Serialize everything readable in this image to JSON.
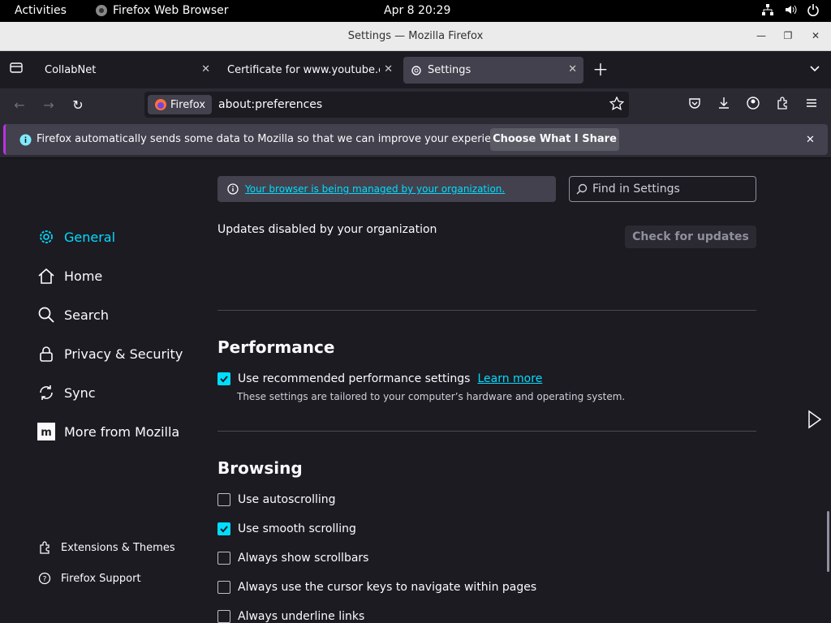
{
  "system": {
    "activities": "Activities",
    "app": "Firefox Web Browser",
    "clock": "Apr 8  20:29"
  },
  "window": {
    "title": "Settings — Mozilla Firefox"
  },
  "tabs": [
    {
      "label": "CollabNet"
    },
    {
      "label": "Certificate for www.youtube.co"
    },
    {
      "label": "Settings"
    }
  ],
  "navbar": {
    "identity": "Firefox",
    "url": "about:preferences"
  },
  "notification": {
    "message": "Firefox automatically sends some data to Mozilla so that we can improve your experience.",
    "button": "Choose What I Share"
  },
  "sidebar": {
    "items": [
      {
        "label": "General"
      },
      {
        "label": "Home"
      },
      {
        "label": "Search"
      },
      {
        "label": "Privacy & Security"
      },
      {
        "label": "Sync"
      },
      {
        "label": "More from Mozilla"
      }
    ],
    "footer": [
      {
        "label": "Extensions & Themes"
      },
      {
        "label": "Firefox Support"
      }
    ]
  },
  "main": {
    "managed": "Your browser is being managed by your organization.",
    "find_placeholder": "Find in Settings",
    "updates_text": "Updates disabled by your organization",
    "check_updates": "Check for updates",
    "performance": {
      "title": "Performance",
      "recommended": "Use recommended performance settings",
      "learn_more": "Learn more",
      "desc": "These settings are tailored to your computer’s hardware and operating system."
    },
    "browsing": {
      "title": "Browsing",
      "options": [
        {
          "label": "Use autoscrolling",
          "checked": false
        },
        {
          "label": "Use smooth scrolling",
          "checked": true
        },
        {
          "label": "Always show scrollbars",
          "checked": false
        },
        {
          "label": "Always use the cursor keys to navigate within pages",
          "checked": false
        },
        {
          "label": "Always underline links",
          "checked": false
        }
      ]
    }
  }
}
